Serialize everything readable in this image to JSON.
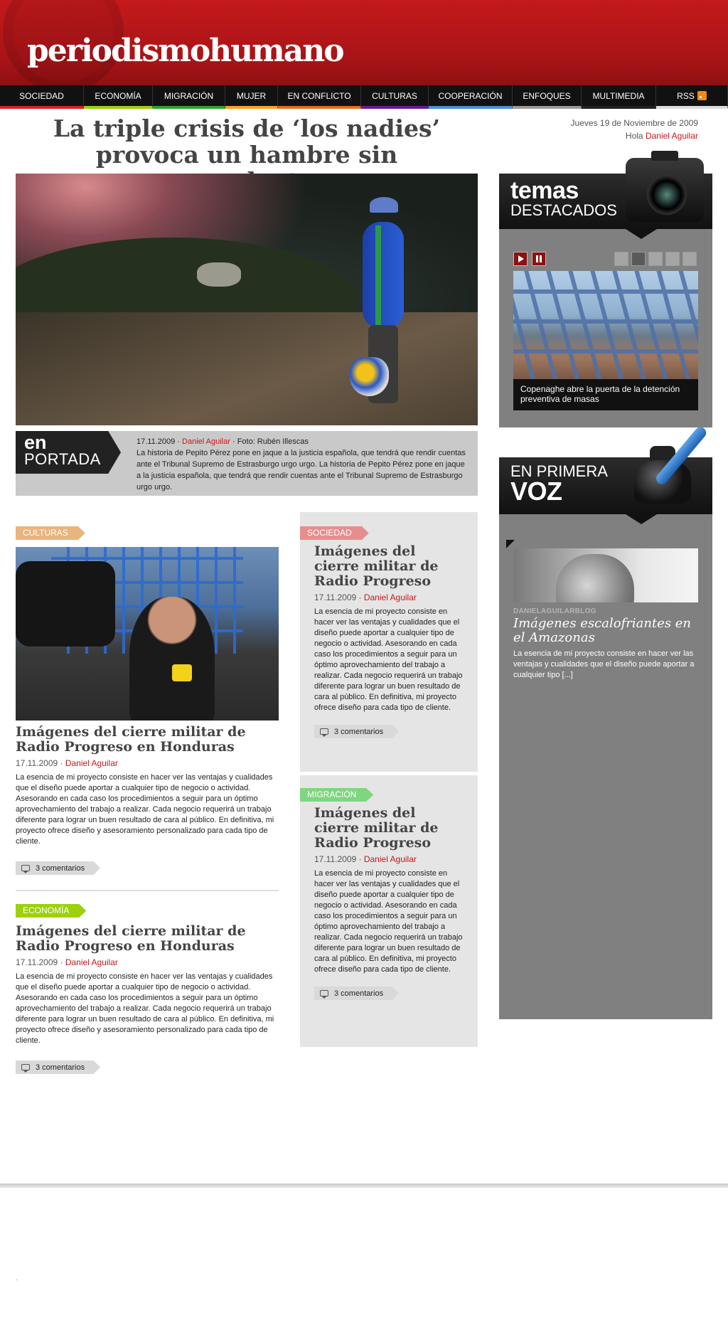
{
  "site": {
    "logo_text": "periodismohumano"
  },
  "nav": {
    "items": [
      {
        "label": "Sociedad",
        "color": "#e31e24"
      },
      {
        "label": "Economía",
        "color": "#9dd00f"
      },
      {
        "label": "Migración",
        "color": "#2aa72a"
      },
      {
        "label": "Mujer",
        "color": "#f6a323"
      },
      {
        "label": "En conflicto",
        "color": "#e3701c"
      },
      {
        "label": "Culturas",
        "color": "#6a1b9a"
      },
      {
        "label": "Cooperación",
        "color": "#4a90d9"
      },
      {
        "label": "Enfoques",
        "color": "#9b9b9b"
      },
      {
        "label": "Multimedia",
        "color": "#222222"
      },
      {
        "label": "RSS",
        "color": "#dddddd"
      }
    ]
  },
  "topbar": {
    "date": "Jueves 19 de Noviembre de 2009",
    "greeting": "Hola",
    "user": "Daniel Aguilar"
  },
  "lead": {
    "headline": "La triple crisis de ‘los nadies’ provoca un hambre sin precedentes",
    "portada_en": "en",
    "portada_label": "PORTADA",
    "date": "17.11.2009 ·",
    "author": "Daniel Aguilar",
    "credit": "· Foto: Rubén Illescas",
    "summary": "La historia de Pepito Pérez pone en jaque a la justicia española, que tendrá que rendir cuentas ante el Tribunal Supremo de Estrasburgo urgo urgo. La historia de Pepito Pérez pone en jaque a la justicia española, que tendrá que rendir cuentas ante el Tribunal Supremo de Estrasburgo urgo urgo."
  },
  "articles": {
    "culturas": {
      "category": "Culturas",
      "category_color": "#e9b47e",
      "title": "Imágenes del cierre militar de Radio Progreso en Honduras",
      "date": "17.11.2009 ·",
      "author": "Daniel Aguilar",
      "body": "La esencia de mi proyecto consiste en hacer ver las ventajas y cualidades que el diseño puede aportar a cualquier tipo de negocio o  actividad. Asesorando en cada caso los procedimientos a seguir para un óptimo aprovechamiento del trabajo a realizar. Cada negocio requerirá un trabajo diferente para lograr un buen resultado de cara al público. En definitiva, mi proyecto ofrece diseño y asesoramiento personalizado para cada tipo de cliente.",
      "comments": "3 comentarios"
    },
    "economia": {
      "category": "Economía",
      "category_color": "#9dd00f",
      "title": "Imágenes del cierre militar de Radio Progreso en Honduras",
      "date": "17.11.2009 ·",
      "author": "Daniel Aguilar",
      "body": "La esencia de mi proyecto consiste en hacer ver las ventajas y cualidades que el diseño puede aportar a cualquier tipo de negocio o  actividad. Asesorando en cada caso los procedimientos a seguir para un óptimo aprovechamiento del trabajo a realizar. Cada negocio requerirá un trabajo diferente para lograr un buen resultado de cara al público. En definitiva, mi proyecto ofrece diseño y asesoramiento personalizado para cada tipo de cliente.",
      "comments": "3 comentarios"
    },
    "sociedad": {
      "category": "Sociedad",
      "category_color": "#e88d8d",
      "title": "Imágenes del cierre militar de Radio Progreso",
      "date": "17.11.2009 ·",
      "author": "Daniel Aguilar",
      "body": "La esencia de mi proyecto consiste en hacer ver las ventajas y cualidades que el diseño puede aportar a cualquier tipo de negocio o  actividad. Asesorando en cada caso los procedimientos a seguir para un óptimo aprovechamiento del trabajo a realizar. Cada negocio requerirá un trabajo diferente para lograr un buen resultado de cara al público. En definitiva, mi proyecto ofrece diseño para cada tipo de cliente.",
      "comments": "3 comentarios"
    },
    "migracion": {
      "category": "Migración",
      "category_color": "#7ed67e",
      "title": "Imágenes del cierre militar de Radio Progreso",
      "date": "17.11.2009 ·",
      "author": "Daniel Aguilar",
      "body": "La esencia de mi proyecto consiste en hacer ver las ventajas y cualidades que el diseño puede aportar a cualquier tipo de negocio o  actividad. Asesorando en cada caso los procedimientos a seguir para un óptimo aprovechamiento del trabajo a realizar. Cada negocio requerirá un trabajo diferente para lograr un buen resultado de cara al público. En definitiva, mi proyecto ofrece diseño para cada tipo de cliente.",
      "comments": "3 comentarios"
    }
  },
  "temas": {
    "title_top": "temas",
    "title_bottom": "DESTACADOS",
    "caption": "Copenaghe abre la puerta de la detención preventiva de masas",
    "active_slide": 2,
    "slide_count": 5
  },
  "voz": {
    "title_top": "EN PRIMERA",
    "title_bottom": "VOZ",
    "blog": "DanielAguilarBlog",
    "title": "Imágenes escalofriantes en el Amazonas",
    "body": "La esencia de mi proyecto consiste en hacer ver las ventajas y cualidades que el diseño puede aportar a cualquier tipo [...]"
  },
  "footer": {
    "mark": "."
  }
}
